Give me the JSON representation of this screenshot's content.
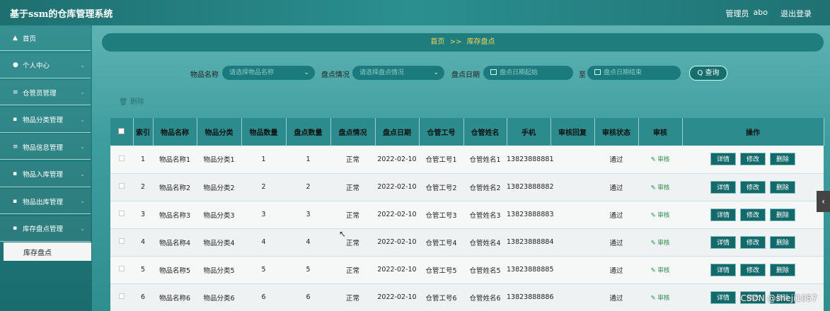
{
  "app": {
    "title": "基于ssm的仓库管理系统",
    "user_label": "管理员",
    "username": "abo",
    "logout": "退出登录"
  },
  "sidebar": {
    "items": [
      {
        "icon": "home-icon",
        "glyph": "▲",
        "label": "首页"
      },
      {
        "icon": "user-icon",
        "glyph": "●",
        "label": "个人中心"
      },
      {
        "icon": "list-icon",
        "glyph": "≡",
        "label": "仓管员管理"
      },
      {
        "icon": "grid-icon",
        "glyph": "▪",
        "label": "物品分类管理"
      },
      {
        "icon": "list-icon",
        "glyph": "≡",
        "label": "物品信息管理"
      },
      {
        "icon": "grid-icon",
        "glyph": "▪",
        "label": "物品入库管理"
      },
      {
        "icon": "grid-icon",
        "glyph": "▪",
        "label": "物品出库管理"
      },
      {
        "icon": "grid-icon",
        "glyph": "▪",
        "label": "库存盘点管理"
      }
    ],
    "active_sub": "库存盘点"
  },
  "breadcrumb": {
    "home": "首页",
    "sep": ">>",
    "current": "库存盘点"
  },
  "filters": {
    "name_label": "物品名称",
    "name_placeholder": "请选择物品名称",
    "status_label": "盘点情况",
    "status_placeholder": "请选择盘点情况",
    "date_label": "盘点日期",
    "date_start": "盘点日期起始",
    "date_to": "至",
    "date_end": "盘点日期结束",
    "search": "Q 查询"
  },
  "bulk_delete": "删除",
  "table": {
    "headers": [
      "",
      "索引",
      "物品名称",
      "物品分类",
      "物品数量",
      "盘点数量",
      "盘点情况",
      "盘点日期",
      "仓管工号",
      "仓管姓名",
      "手机",
      "审核回复",
      "审核状态",
      "审核",
      "操作"
    ],
    "rows": [
      [
        "1",
        "物品名称1",
        "物品分类1",
        "1",
        "1",
        "正常",
        "2022-02-10",
        "仓管工号1",
        "仓管姓名1",
        "13823888881",
        "",
        "通过"
      ],
      [
        "2",
        "物品名称2",
        "物品分类2",
        "2",
        "2",
        "正常",
        "2022-02-10",
        "仓管工号2",
        "仓管姓名2",
        "13823888882",
        "",
        "通过"
      ],
      [
        "3",
        "物品名称3",
        "物品分类3",
        "3",
        "3",
        "正常",
        "2022-02-10",
        "仓管工号3",
        "仓管姓名3",
        "13823888883",
        "",
        "通过"
      ],
      [
        "4",
        "物品名称4",
        "物品分类4",
        "4",
        "4",
        "正常",
        "2022-02-10",
        "仓管工号4",
        "仓管姓名4",
        "13823888884",
        "",
        "通过"
      ],
      [
        "5",
        "物品名称5",
        "物品分类5",
        "5",
        "5",
        "正常",
        "2022-02-10",
        "仓管工号5",
        "仓管姓名5",
        "13823888885",
        "",
        "通过"
      ],
      [
        "6",
        "物品名称6",
        "物品分类6",
        "6",
        "6",
        "正常",
        "2022-02-10",
        "仓管工号6",
        "仓管姓名6",
        "13823888886",
        "",
        "通过"
      ]
    ],
    "audit_label": "审核",
    "actions": [
      "详情",
      "修改",
      "删除"
    ]
  },
  "watermark": "CSDN @sheji1057"
}
